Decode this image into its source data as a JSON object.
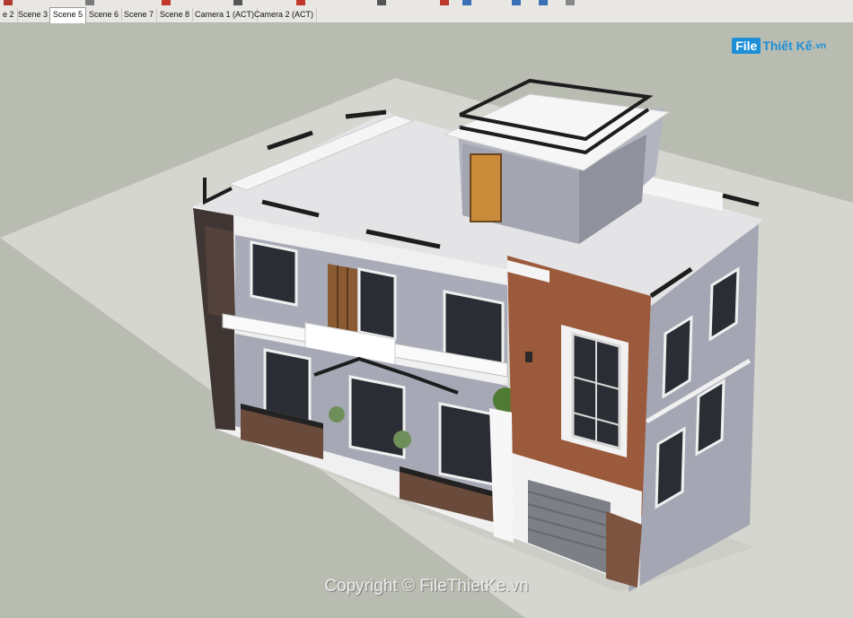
{
  "tabs": [
    {
      "label": "e 2",
      "active": false
    },
    {
      "label": "Scene 3",
      "active": false
    },
    {
      "label": "Scene 5",
      "active": true
    },
    {
      "label": "Scene 6",
      "active": false
    },
    {
      "label": "Scene 7",
      "active": false
    },
    {
      "label": "Scene 8",
      "active": false
    },
    {
      "label": "Camera 1 (ACT)",
      "active": false
    },
    {
      "label": "Camera 2 (ACT)",
      "active": false
    }
  ],
  "watermark": {
    "logo_file": "File",
    "logo_rest": "Thiết Kế",
    "logo_tld": ".vn",
    "copyright": "Copyright © FileThietKe.vn"
  },
  "colors": {
    "sky": "#b9bcb1",
    "ground": "#d5d6cf",
    "wall_white": "#f2f2f2",
    "wall_grey": "#a4a7b3",
    "brick": "#9c5a3c",
    "dark_wood": "#4a3a33",
    "railing": "#1d1d1d",
    "logo_blue": "#1d8fd6"
  }
}
